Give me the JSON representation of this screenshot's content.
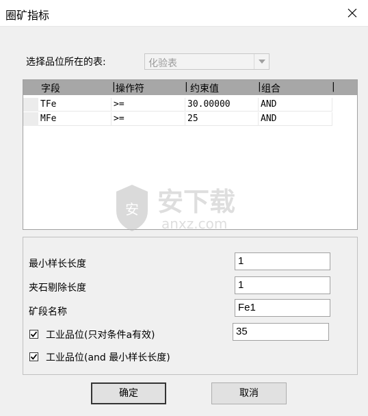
{
  "window": {
    "title": "圈矿指标"
  },
  "table_select": {
    "label": "选择品位所在的表:",
    "value": "化验表"
  },
  "grid": {
    "columns": [
      "字段",
      "操作符",
      "约束值",
      "组合"
    ],
    "rows": [
      [
        "TFe",
        ">=",
        "30.00000",
        "AND"
      ],
      [
        "MFe",
        ">=",
        "25",
        "AND"
      ]
    ]
  },
  "watermark": {
    "brand": "安下载",
    "domain": "anxz.com",
    "shield": "安"
  },
  "form": {
    "min_sample_length": {
      "label": "最小样长长度",
      "value": "1"
    },
    "waste_length": {
      "label": "夹石剔除长度",
      "value": "1"
    },
    "segment_name": {
      "label": "矿段名称",
      "value": "Fe1"
    },
    "industrial_grade_a": {
      "label": "工业品位(只对条件a有效)",
      "value": "35",
      "checked": true
    },
    "industrial_grade_and": {
      "label": "工业品位(and 最小样长长度)",
      "checked": true
    }
  },
  "buttons": {
    "ok": "确定",
    "cancel": "取消"
  }
}
